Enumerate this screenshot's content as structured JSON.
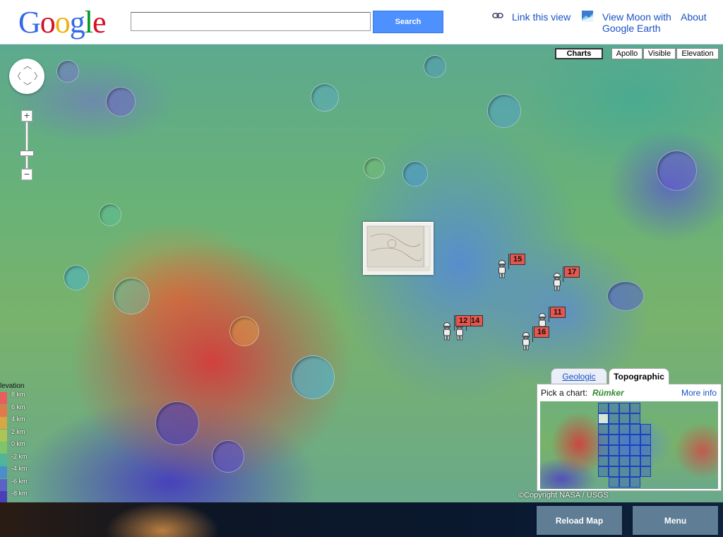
{
  "header": {
    "logo_letters": [
      "G",
      "o",
      "o",
      "g",
      "l",
      "e"
    ],
    "logo_colors": [
      "#3369e8",
      "#d50f25",
      "#eeb211",
      "#3369e8",
      "#009925",
      "#d50f25"
    ],
    "search_placeholder": "",
    "search_button": "Search",
    "link_this_view": "Link this view",
    "view_moon_line1": "View Moon with",
    "view_moon_line2": "Google Earth",
    "about": "About"
  },
  "map_types": {
    "charts": "Charts",
    "apollo": "Apollo",
    "visible": "Visible",
    "elevation": "Elevation",
    "selected": "Charts"
  },
  "apollo_sites": [
    "15",
    "17",
    "11",
    "14",
    "16",
    "12"
  ],
  "elevation_legend": {
    "title": "levation",
    "labels": [
      "8 km",
      "6 km",
      "4 km",
      "2 km",
      "0 km",
      "-2 km",
      "-4 km",
      "-6 km",
      "-8 km"
    ],
    "colors": [
      "#e85d5d",
      "#e07a4a",
      "#d6a844",
      "#aec455",
      "#7ec46a",
      "#4fb49a",
      "#4a8fc9",
      "#5a64c6",
      "#4a3fb6"
    ]
  },
  "chart_picker": {
    "tab_geologic": "Geologic",
    "tab_topographic": "Topographic",
    "active_tab": "Topographic",
    "pick_label": "Pick a chart:",
    "selected_chart": "Rümker",
    "more_info": "More info"
  },
  "copyright": "©Copyright NASA / USGS",
  "footer": {
    "reload_map": "Reload Map",
    "menu": "Menu"
  }
}
